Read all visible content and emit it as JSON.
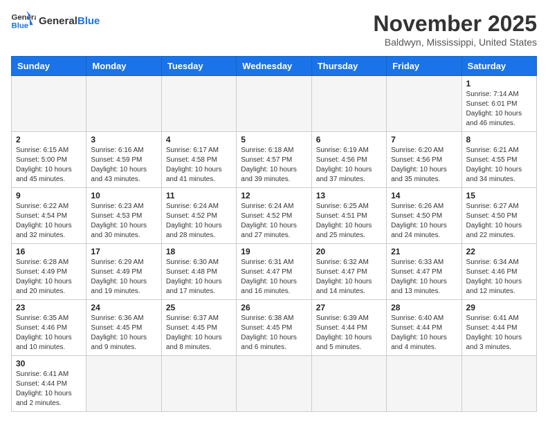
{
  "header": {
    "logo_general": "General",
    "logo_blue": "Blue",
    "month": "November 2025",
    "location": "Baldwyn, Mississippi, United States"
  },
  "weekdays": [
    "Sunday",
    "Monday",
    "Tuesday",
    "Wednesday",
    "Thursday",
    "Friday",
    "Saturday"
  ],
  "weeks": [
    [
      {
        "day": "",
        "info": ""
      },
      {
        "day": "",
        "info": ""
      },
      {
        "day": "",
        "info": ""
      },
      {
        "day": "",
        "info": ""
      },
      {
        "day": "",
        "info": ""
      },
      {
        "day": "",
        "info": ""
      },
      {
        "day": "1",
        "info": "Sunrise: 7:14 AM\nSunset: 6:01 PM\nDaylight: 10 hours and 46 minutes."
      }
    ],
    [
      {
        "day": "2",
        "info": "Sunrise: 6:15 AM\nSunset: 5:00 PM\nDaylight: 10 hours and 45 minutes."
      },
      {
        "day": "3",
        "info": "Sunrise: 6:16 AM\nSunset: 4:59 PM\nDaylight: 10 hours and 43 minutes."
      },
      {
        "day": "4",
        "info": "Sunrise: 6:17 AM\nSunset: 4:58 PM\nDaylight: 10 hours and 41 minutes."
      },
      {
        "day": "5",
        "info": "Sunrise: 6:18 AM\nSunset: 4:57 PM\nDaylight: 10 hours and 39 minutes."
      },
      {
        "day": "6",
        "info": "Sunrise: 6:19 AM\nSunset: 4:56 PM\nDaylight: 10 hours and 37 minutes."
      },
      {
        "day": "7",
        "info": "Sunrise: 6:20 AM\nSunset: 4:56 PM\nDaylight: 10 hours and 35 minutes."
      },
      {
        "day": "8",
        "info": "Sunrise: 6:21 AM\nSunset: 4:55 PM\nDaylight: 10 hours and 34 minutes."
      }
    ],
    [
      {
        "day": "9",
        "info": "Sunrise: 6:22 AM\nSunset: 4:54 PM\nDaylight: 10 hours and 32 minutes."
      },
      {
        "day": "10",
        "info": "Sunrise: 6:23 AM\nSunset: 4:53 PM\nDaylight: 10 hours and 30 minutes."
      },
      {
        "day": "11",
        "info": "Sunrise: 6:24 AM\nSunset: 4:52 PM\nDaylight: 10 hours and 28 minutes."
      },
      {
        "day": "12",
        "info": "Sunrise: 6:24 AM\nSunset: 4:52 PM\nDaylight: 10 hours and 27 minutes."
      },
      {
        "day": "13",
        "info": "Sunrise: 6:25 AM\nSunset: 4:51 PM\nDaylight: 10 hours and 25 minutes."
      },
      {
        "day": "14",
        "info": "Sunrise: 6:26 AM\nSunset: 4:50 PM\nDaylight: 10 hours and 24 minutes."
      },
      {
        "day": "15",
        "info": "Sunrise: 6:27 AM\nSunset: 4:50 PM\nDaylight: 10 hours and 22 minutes."
      }
    ],
    [
      {
        "day": "16",
        "info": "Sunrise: 6:28 AM\nSunset: 4:49 PM\nDaylight: 10 hours and 20 minutes."
      },
      {
        "day": "17",
        "info": "Sunrise: 6:29 AM\nSunset: 4:49 PM\nDaylight: 10 hours and 19 minutes."
      },
      {
        "day": "18",
        "info": "Sunrise: 6:30 AM\nSunset: 4:48 PM\nDaylight: 10 hours and 17 minutes."
      },
      {
        "day": "19",
        "info": "Sunrise: 6:31 AM\nSunset: 4:47 PM\nDaylight: 10 hours and 16 minutes."
      },
      {
        "day": "20",
        "info": "Sunrise: 6:32 AM\nSunset: 4:47 PM\nDaylight: 10 hours and 14 minutes."
      },
      {
        "day": "21",
        "info": "Sunrise: 6:33 AM\nSunset: 4:47 PM\nDaylight: 10 hours and 13 minutes."
      },
      {
        "day": "22",
        "info": "Sunrise: 6:34 AM\nSunset: 4:46 PM\nDaylight: 10 hours and 12 minutes."
      }
    ],
    [
      {
        "day": "23",
        "info": "Sunrise: 6:35 AM\nSunset: 4:46 PM\nDaylight: 10 hours and 10 minutes."
      },
      {
        "day": "24",
        "info": "Sunrise: 6:36 AM\nSunset: 4:45 PM\nDaylight: 10 hours and 9 minutes."
      },
      {
        "day": "25",
        "info": "Sunrise: 6:37 AM\nSunset: 4:45 PM\nDaylight: 10 hours and 8 minutes."
      },
      {
        "day": "26",
        "info": "Sunrise: 6:38 AM\nSunset: 4:45 PM\nDaylight: 10 hours and 6 minutes."
      },
      {
        "day": "27",
        "info": "Sunrise: 6:39 AM\nSunset: 4:44 PM\nDaylight: 10 hours and 5 minutes."
      },
      {
        "day": "28",
        "info": "Sunrise: 6:40 AM\nSunset: 4:44 PM\nDaylight: 10 hours and 4 minutes."
      },
      {
        "day": "29",
        "info": "Sunrise: 6:41 AM\nSunset: 4:44 PM\nDaylight: 10 hours and 3 minutes."
      }
    ],
    [
      {
        "day": "30",
        "info": "Sunrise: 6:41 AM\nSunset: 4:44 PM\nDaylight: 10 hours and 2 minutes."
      },
      {
        "day": "",
        "info": ""
      },
      {
        "day": "",
        "info": ""
      },
      {
        "day": "",
        "info": ""
      },
      {
        "day": "",
        "info": ""
      },
      {
        "day": "",
        "info": ""
      },
      {
        "day": "",
        "info": ""
      }
    ]
  ]
}
